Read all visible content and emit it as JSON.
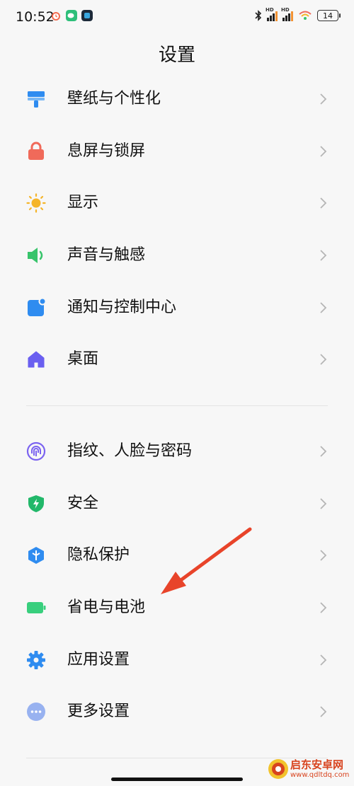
{
  "status_bar": {
    "time": "10:52",
    "hd1": "HD",
    "hd2": "HD",
    "battery": "14",
    "icons": [
      "alarm-icon",
      "wechat-icon",
      "app-icon",
      "bluetooth-icon",
      "signal-icon",
      "signal-icon",
      "wifi-icon",
      "battery-icon"
    ]
  },
  "header": {
    "title": "设置"
  },
  "groups": [
    {
      "items": [
        {
          "label": "壁纸与个性化",
          "icon": "paint-roller-icon",
          "color": "#2f8cf0"
        },
        {
          "label": "息屏与锁屏",
          "icon": "lock-icon",
          "color": "#f06a5a"
        },
        {
          "label": "显示",
          "icon": "sun-icon",
          "color": "#f5b52a"
        },
        {
          "label": "声音与触感",
          "icon": "speaker-icon",
          "color": "#38c46b"
        },
        {
          "label": "通知与控制中心",
          "icon": "notification-icon",
          "color": "#2f8cf0"
        },
        {
          "label": "桌面",
          "icon": "home-icon",
          "color": "#6a5ff0"
        }
      ]
    },
    {
      "items": [
        {
          "label": "指纹、人脸与密码",
          "icon": "fingerprint-icon",
          "color": "#7b63f0"
        },
        {
          "label": "安全",
          "icon": "shield-icon",
          "color": "#22b86a"
        },
        {
          "label": "隐私保护",
          "icon": "privacy-icon",
          "color": "#2f8cf0"
        },
        {
          "label": "省电与电池",
          "icon": "battery-icon",
          "color": "#38cf7d"
        },
        {
          "label": "应用设置",
          "icon": "gear-icon",
          "color": "#2f8cf0"
        },
        {
          "label": "更多设置",
          "icon": "more-icon",
          "color": "#98b2f0"
        }
      ]
    }
  ],
  "annotation": {
    "icon": "red-arrow-icon",
    "color": "#e8442a"
  },
  "watermark": {
    "title": "启东安卓网",
    "url": "www.qdltdq.com"
  }
}
